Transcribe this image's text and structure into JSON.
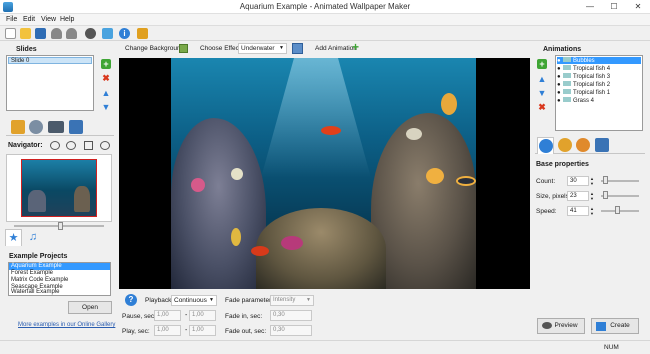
{
  "window": {
    "title": "Aquarium Example - Animated Wallpaper Maker",
    "minimize": "—",
    "maximize": "☐",
    "close": "✕"
  },
  "menu": [
    "File",
    "Edit",
    "View",
    "Help"
  ],
  "slides": {
    "title": "Slides",
    "items": [
      "Slide 0"
    ]
  },
  "navigator": {
    "title": "Navigator:"
  },
  "projects": {
    "title": "Example Projects",
    "items": [
      "Aquarium Example",
      "Forest Example",
      "Matrix Code Example",
      "Seascape Example",
      "Waterfall Example"
    ],
    "open_label": "Open",
    "link": "More examples in our Online Gallery"
  },
  "center_toolbar": {
    "change_background": "Change Background",
    "choose_effect_label": "Choose Effect:",
    "effect_value": "Underwater",
    "add_animation": "Add Animation"
  },
  "playback": {
    "label": "Playback:",
    "value": "Continuous",
    "pause_label": "Pause, sec:",
    "pause_from": "1,00",
    "pause_to": "1,00",
    "play_label": "Play, sec:",
    "play_from": "1,00",
    "play_to": "1,00",
    "dash": "-",
    "fade_param_label": "Fade parameter:",
    "fade_param_value": "Intensity",
    "fade_in_label": "Fade in, sec:",
    "fade_in_value": "0,30",
    "fade_out_label": "Fade out, sec:",
    "fade_out_value": "0,30"
  },
  "animations": {
    "title": "Animations",
    "items": [
      "Bubbles",
      "Tropical fish 4",
      "Tropical fish 3",
      "Tropical fish 2",
      "Tropical fish 1",
      "Grass 4"
    ]
  },
  "base_properties": {
    "title": "Base properties",
    "count_label": "Count:",
    "count_value": "30",
    "size_label": "Size, pixels:",
    "size_value": "23",
    "speed_label": "Speed:",
    "speed_value": "41"
  },
  "actions": {
    "preview": "Preview",
    "create": "Create"
  },
  "status": {
    "num": "NUM"
  },
  "colors": {
    "accent": "#3399ff",
    "ocean_top": "#0d5f86",
    "ocean_bottom": "#052a3d"
  }
}
